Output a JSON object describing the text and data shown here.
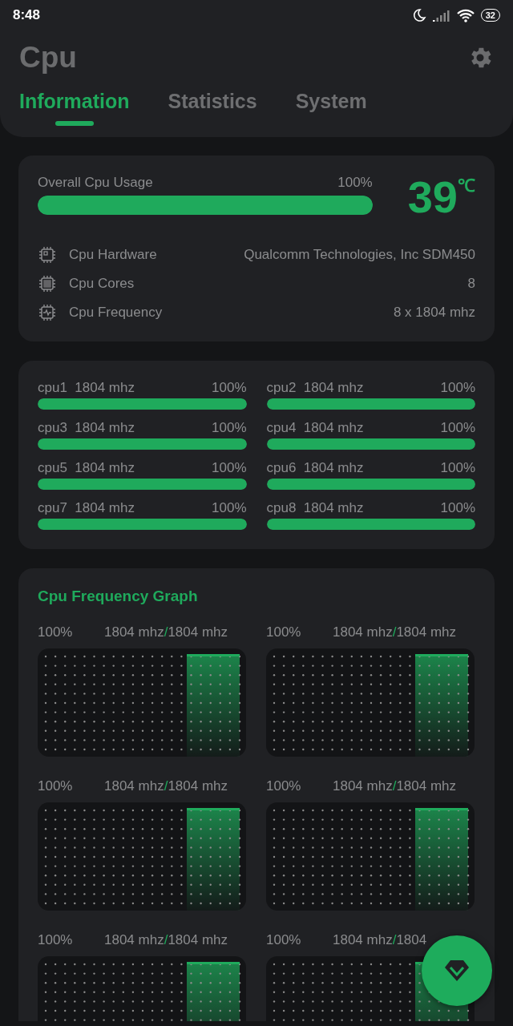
{
  "status_bar": {
    "time": "8:48",
    "battery": "32"
  },
  "app_bar": {
    "title": "Cpu"
  },
  "tabs": [
    {
      "label": "Information",
      "selected": true
    },
    {
      "label": "Statistics",
      "selected": false
    },
    {
      "label": "System",
      "selected": false
    }
  ],
  "usage": {
    "label": "Overall Cpu Usage",
    "reading": "100%",
    "level": 1.0,
    "temperature": "39",
    "unit": "℃"
  },
  "info_rows": [
    {
      "kind": "hardware",
      "label": "Cpu Hardware",
      "value": "Qualcomm Technologies, Inc SDM450"
    },
    {
      "kind": "cores",
      "label": "Cpu Cores",
      "value": "8"
    },
    {
      "kind": "frequency",
      "label": "Cpu Frequency",
      "value": "8 x 1804 mhz"
    }
  ],
  "cores": [
    {
      "name": "cpu1",
      "frequency": "1804 mhz",
      "reading": "100%",
      "level": 1.0
    },
    {
      "name": "cpu2",
      "frequency": "1804 mhz",
      "reading": "100%",
      "level": 1.0
    },
    {
      "name": "cpu3",
      "frequency": "1804 mhz",
      "reading": "100%",
      "level": 1.0
    },
    {
      "name": "cpu4",
      "frequency": "1804 mhz",
      "reading": "100%",
      "level": 1.0
    },
    {
      "name": "cpu5",
      "frequency": "1804 mhz",
      "reading": "100%",
      "level": 1.0
    },
    {
      "name": "cpu6",
      "frequency": "1804 mhz",
      "reading": "100%",
      "level": 1.0
    },
    {
      "name": "cpu7",
      "frequency": "1804 mhz",
      "reading": "100%",
      "level": 1.0
    },
    {
      "name": "cpu8",
      "frequency": "1804 mhz",
      "reading": "100%",
      "level": 1.0
    }
  ],
  "graph_card": {
    "title": "Cpu Frequency Graph",
    "graphs": [
      {
        "reading": "100%",
        "current": "1804 mhz",
        "separator": "/",
        "max": "1804 mhz"
      },
      {
        "reading": "100%",
        "current": "1804 mhz",
        "separator": "/",
        "max": "1804 mhz"
      },
      {
        "reading": "100%",
        "current": "1804 mhz",
        "separator": "/",
        "max": "1804 mhz"
      },
      {
        "reading": "100%",
        "current": "1804 mhz",
        "separator": "/",
        "max": "1804 mhz"
      },
      {
        "reading": "100%",
        "current": "1804 mhz",
        "separator": "/",
        "max": "1804 mhz"
      },
      {
        "reading": "100%",
        "current": "1804 mhz",
        "separator": "/",
        "max": "1804"
      }
    ]
  }
}
